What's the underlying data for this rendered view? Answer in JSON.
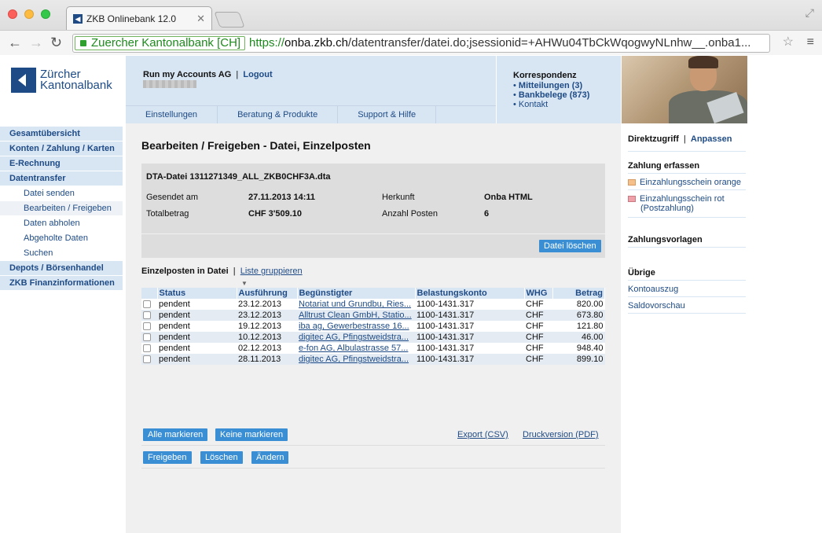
{
  "browser": {
    "tab_title": "ZKB Onlinebank 12.0",
    "tab_close": "✕",
    "ev_label": "Zuercher Kantonalbank [CH]",
    "url_prefix": "https://",
    "url_host": "onba.zkb.ch",
    "url_path": "/datentransfer/datei.do;jsessionid=+AHWu04TbCkWqogwyNLnhw__.onba1..."
  },
  "logo": {
    "line1": "Zürcher",
    "line2": "Kantonalbank"
  },
  "header": {
    "account": "Run my Accounts AG",
    "separator": "|",
    "logout": "Logout",
    "nav": [
      "Einstellungen",
      "Beratung & Produkte",
      "Support & Hilfe"
    ]
  },
  "correspondence": {
    "title": "Korrespondenz",
    "items": [
      "Mitteilungen (3)",
      "Bankbelege (873)",
      "Kontakt"
    ]
  },
  "sidebar": {
    "items": [
      "Gesamtübersicht",
      "Konten / Zahlung / Karten",
      "E-Rechnung",
      "Datentransfer",
      "Datei senden",
      "Bearbeiten / Freigeben",
      "Daten abholen",
      "Abgeholte Daten",
      "Suchen",
      "Depots / Börsenhandel",
      "ZKB Finanzinformationen"
    ]
  },
  "main": {
    "title": "Bearbeiten / Freigeben - Datei, Einzelposten",
    "file_name": "DTA-Datei 1311271349_ALL_ZKB0CHF3A.dta",
    "sent_label": "Gesendet am",
    "sent_value": "27.11.2013 14:11",
    "origin_label": "Herkunft",
    "origin_value": "Onba HTML",
    "total_label": "Totalbetrag",
    "total_value": "CHF 3'509.10",
    "count_label": "Anzahl Posten",
    "count_value": "6",
    "delete_file": "Datei löschen",
    "section_title": "Einzelposten in Datei",
    "section_sep": "|",
    "group_list": "Liste gruppieren",
    "sort_marker": "▼",
    "columns": [
      "Status",
      "Ausführung",
      "Begünstigter",
      "Belastungskonto",
      "WHG",
      "Betrag"
    ],
    "rows": [
      [
        "pendent",
        "23.12.2013",
        "Notariat und Grundbu, Ries...",
        "1100-1431.317",
        "CHF",
        "820.00"
      ],
      [
        "pendent",
        "23.12.2013",
        "Alltrust Clean GmbH, Statio...",
        "1100-1431.317",
        "CHF",
        "673.80"
      ],
      [
        "pendent",
        "19.12.2013",
        "iba ag, Gewerbestrasse 16...",
        "1100-1431.317",
        "CHF",
        "121.80"
      ],
      [
        "pendent",
        "10.12.2013",
        "digitec AG, Pfingstweidstra...",
        "1100-1431.317",
        "CHF",
        "46.00"
      ],
      [
        "pendent",
        "02.12.2013",
        "e-fon AG, Albulastrasse 57...",
        "1100-1431.317",
        "CHF",
        "948.40"
      ],
      [
        "pendent",
        "28.11.2013",
        "digitec AG, Pfingstweidstra...",
        "1100-1431.317",
        "CHF",
        "899.10"
      ]
    ],
    "select_all": "Alle markieren",
    "select_none": "Keine markieren",
    "export_csv": "Export (CSV)",
    "print_pdf": "Druckversion (PDF)",
    "release": "Freigeben",
    "delete": "Löschen",
    "edit": "Ändern"
  },
  "right": {
    "quick": "Direktzugriff",
    "quick_sep": "|",
    "customize": "Anpassen",
    "payment_title": "Zahlung erfassen",
    "orange_slip": "Einzahlungsschein orange",
    "red_slip_1": "Einzahlungsschein rot",
    "red_slip_2": "(Postzahlung)",
    "templates_title": "Zahlungsvorlagen",
    "other_title": "Übrige",
    "statement": "Kontoauszug",
    "balance_preview": "Saldovorschau",
    "orange_color": "#f5c08a",
    "red_color": "#f0a0a8"
  }
}
